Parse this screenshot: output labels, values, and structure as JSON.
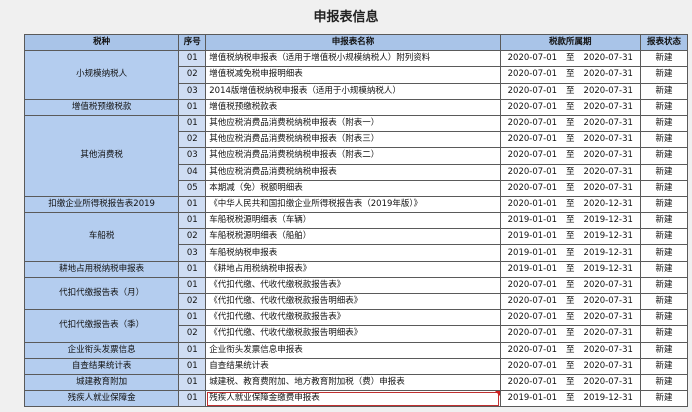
{
  "page_title": "申报表信息",
  "columns": [
    "税种",
    "序号",
    "申报表名称",
    "税款所属期",
    "报表状态"
  ],
  "groups": [
    {
      "category": "小规模纳税人",
      "rows": [
        {
          "idx": "01",
          "name": "增值税纳税申报表（适用于增值税小规模纳税人）附列资料",
          "start": "2020-07-01",
          "sep": "至",
          "end": "2020-07-31",
          "status": "新建"
        },
        {
          "idx": "02",
          "name": "增值税减免税申报明细表",
          "start": "2020-07-01",
          "sep": "至",
          "end": "2020-07-31",
          "status": "新建"
        },
        {
          "idx": "03",
          "name": "2014版增值税纳税申报表（适用于小规模纳税人）",
          "start": "2020-07-01",
          "sep": "至",
          "end": "2020-07-31",
          "status": "新建"
        }
      ]
    },
    {
      "category": "增值税预缴税款",
      "rows": [
        {
          "idx": "01",
          "name": "增值税预缴税款表",
          "start": "2020-07-01",
          "sep": "至",
          "end": "2020-07-31",
          "status": "新建"
        }
      ]
    },
    {
      "category": "其他消费税",
      "rows": [
        {
          "idx": "01",
          "name": "其他应税消费品消费税纳税申报表（附表一）",
          "start": "2020-07-01",
          "sep": "至",
          "end": "2020-07-31",
          "status": "新建"
        },
        {
          "idx": "02",
          "name": "其他应税消费品消费税纳税申报表（附表三）",
          "start": "2020-07-01",
          "sep": "至",
          "end": "2020-07-31",
          "status": "新建"
        },
        {
          "idx": "03",
          "name": "其他应税消费品消费税纳税申报表（附表二）",
          "start": "2020-07-01",
          "sep": "至",
          "end": "2020-07-31",
          "status": "新建"
        },
        {
          "idx": "04",
          "name": "其他应税消费品消费税纳税申报表",
          "start": "2020-07-01",
          "sep": "至",
          "end": "2020-07-31",
          "status": "新建"
        },
        {
          "idx": "05",
          "name": "本期减（免）税额明细表",
          "start": "2020-07-01",
          "sep": "至",
          "end": "2020-07-31",
          "status": "新建"
        }
      ]
    },
    {
      "category": "扣缴企业所得税报告表2019",
      "rows": [
        {
          "idx": "01",
          "name": "《中华人民共和国扣缴企业所得税报告表（2019年版）》",
          "start": "2020-01-01",
          "sep": "至",
          "end": "2020-12-31",
          "status": "新建"
        }
      ]
    },
    {
      "category": "车船税",
      "rows": [
        {
          "idx": "01",
          "name": "车船税税源明细表（车辆）",
          "start": "2019-01-01",
          "sep": "至",
          "end": "2019-12-31",
          "status": "新建"
        },
        {
          "idx": "02",
          "name": "车船税税源明细表（船舶）",
          "start": "2019-01-01",
          "sep": "至",
          "end": "2019-12-31",
          "status": "新建"
        },
        {
          "idx": "03",
          "name": "车船税纳税申报表",
          "start": "2019-01-01",
          "sep": "至",
          "end": "2019-12-31",
          "status": "新建"
        }
      ]
    },
    {
      "category": "耕地占用税纳税申报表",
      "rows": [
        {
          "idx": "01",
          "name": "《耕地占用税纳税申报表》",
          "start": "2019-01-01",
          "sep": "至",
          "end": "2019-12-31",
          "status": "新建"
        }
      ]
    },
    {
      "category": "代扣代缴报告表（月）",
      "rows": [
        {
          "idx": "01",
          "name": "《代扣代缴、代收代缴税款报告表》",
          "start": "2020-07-01",
          "sep": "至",
          "end": "2020-07-31",
          "status": "新建"
        },
        {
          "idx": "02",
          "name": "《代扣代缴、代收代缴税款报告明细表》",
          "start": "2020-07-01",
          "sep": "至",
          "end": "2020-07-31",
          "status": "新建"
        }
      ]
    },
    {
      "category": "代扣代缴报告表（季）",
      "rows": [
        {
          "idx": "01",
          "name": "《代扣代缴、代收代缴税款报告表》",
          "start": "2020-07-01",
          "sep": "至",
          "end": "2020-07-31",
          "status": "新建"
        },
        {
          "idx": "02",
          "name": "《代扣代缴、代收代缴税款报告明细表》",
          "start": "2020-07-01",
          "sep": "至",
          "end": "2020-07-31",
          "status": "新建"
        }
      ]
    },
    {
      "category": "企业衔头发票信息",
      "rows": [
        {
          "idx": "01",
          "name": "企业衔头发票信息申报表",
          "start": "2020-07-01",
          "sep": "至",
          "end": "2020-07-31",
          "status": "新建"
        }
      ]
    },
    {
      "category": "自查结果统计表",
      "rows": [
        {
          "idx": "01",
          "name": "自查结果统计表",
          "start": "2020-07-01",
          "sep": "至",
          "end": "2020-07-31",
          "status": "新建"
        }
      ]
    },
    {
      "category": "城建教育附加",
      "rows": [
        {
          "idx": "01",
          "name": "城建税、教育费附加、地方教育附加税（费）申报表",
          "start": "2020-07-01",
          "sep": "至",
          "end": "2020-07-31",
          "status": "新建"
        }
      ]
    },
    {
      "category": "残疾人就业保障金",
      "rows": [
        {
          "idx": "01",
          "name": "残疾人就业保障金缴费申报表",
          "start": "2019-01-01",
          "sep": "至",
          "end": "2019-12-31",
          "status": "新建",
          "selected": true
        }
      ]
    }
  ]
}
